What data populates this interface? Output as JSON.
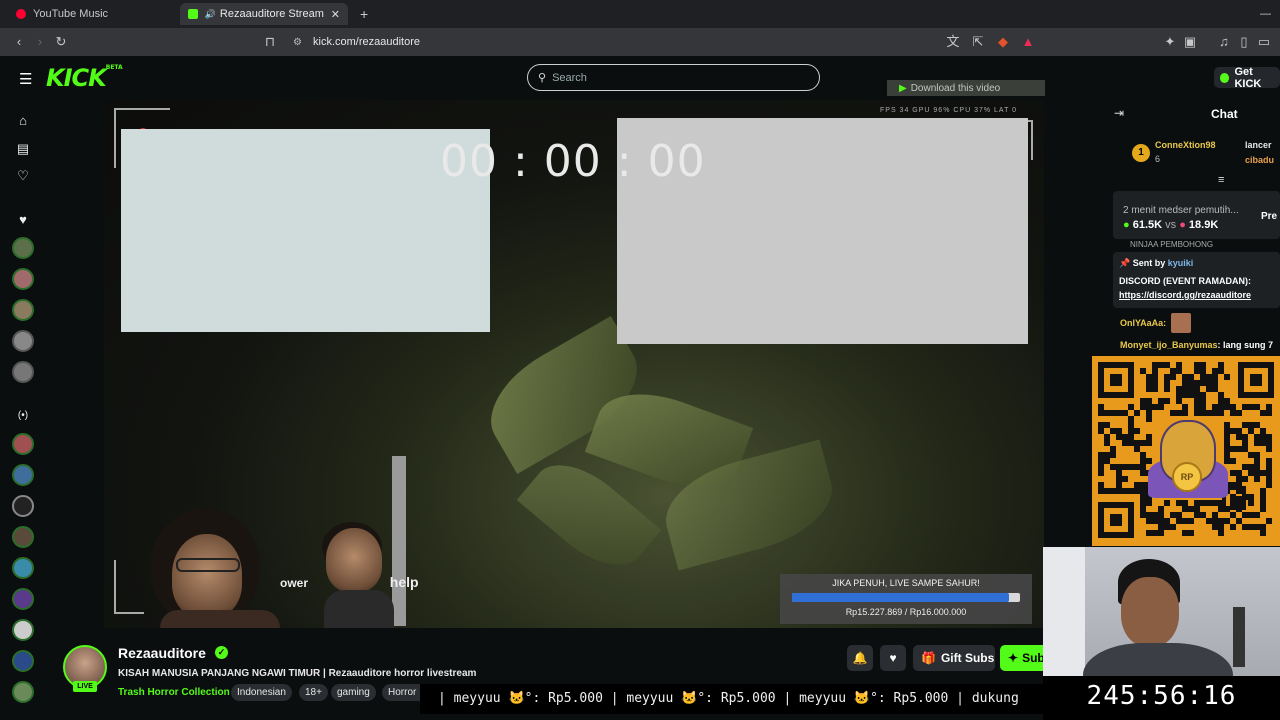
{
  "browser": {
    "tabs": [
      {
        "label": "YouTube Music",
        "color": "#ff0033"
      },
      {
        "label": "Rezaauditore Stream - Watch",
        "color": "#53fc18"
      }
    ],
    "url": "kick.com/rezaauditore",
    "notification_count": "1"
  },
  "header": {
    "logo": "KICK",
    "logo_badge": "BETA",
    "search_placeholder": "Search",
    "get_kick": "Get KICK"
  },
  "video": {
    "timer": "00 : 00 : 00",
    "download_label": "Download this video",
    "stats": "FPS 34   GPU 96%   CPU 37%   LAT 0",
    "overlay_text_1": "ower",
    "overlay_text_2": "help",
    "goal": {
      "title": "JIKA PENUH, LIVE SAMPE SAHUR!",
      "amount": "Rp15.227.869 / Rp16.000.000",
      "progress": 0.952
    }
  },
  "chat": {
    "title": "Chat",
    "leader_rank": "1",
    "leader_name": "ConneXtion98",
    "leader_count": "6",
    "second_name": "lancer",
    "third_name": "cibadu",
    "poll_text": "2 menit medser pemutih...",
    "poll_a": "61.5K",
    "poll_vs": "vs",
    "poll_b": "18.9K",
    "poll_more": "Pre",
    "line_partial": "NINJAA PEMBOHONG",
    "pinned_sent_by": "Sent by",
    "pinned_user": "kyuiki",
    "pinned_title": "DISCORD (EVENT RAMADAN):",
    "pinned_link": "https://discord.gg/rezaauditore",
    "msg1_user": "OnlYAaAa:",
    "msg2_user": "Monyet_ijo_Banyumas",
    "msg2_text": ": lang sung 7"
  },
  "channel": {
    "name": "Rezaauditore",
    "live": "LIVE",
    "title": "KISAH MANUSIA PANJANG NGAWI TIMUR | Rezaauditore horror livestream",
    "category": "Trash Horror Collection",
    "tags": [
      "Indonesian",
      "18+",
      "gaming",
      "Horror"
    ],
    "gift_label": "Gift Subs",
    "sub_label": "Sub",
    "ticker": "| meyyuu 🐱°: Rp5.000 | meyyuu 🐱°: Rp5.000 | meyyuu 🐱°: Rp5.000 |  dukung",
    "clock": "245:56:16"
  },
  "qr": {
    "coin_text": "RP"
  },
  "colors": {
    "accent": "#53fc18",
    "bg": "#0b0e0f",
    "qr_bg": "#e79a1c"
  }
}
